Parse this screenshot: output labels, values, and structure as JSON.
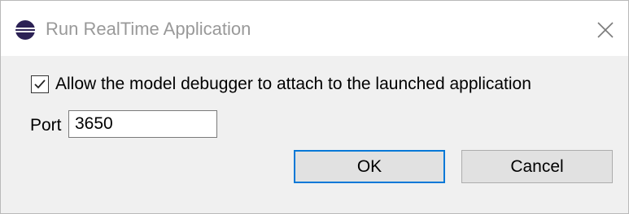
{
  "window": {
    "title": "Run RealTime Application",
    "accent_color": "#0078d7"
  },
  "options": {
    "debugger_checkbox": {
      "label": "Allow the model debugger to attach to the launched application",
      "checked": true
    },
    "port": {
      "label": "Port",
      "value": "3650"
    }
  },
  "buttons": {
    "ok_label": "OK",
    "cancel_label": "Cancel"
  },
  "icons": {
    "app": "eclipse-icon",
    "close": "close-icon",
    "check": "checkmark-icon"
  }
}
